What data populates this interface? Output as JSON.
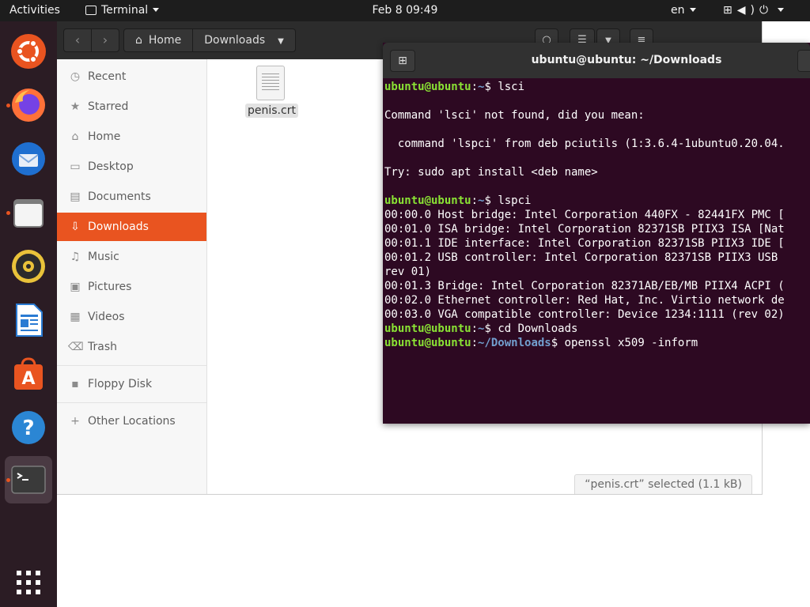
{
  "topbar": {
    "activities": "Activities",
    "app_menu": "Terminal",
    "clock": "Feb 8  09:49",
    "language": "en",
    "system_icons": [
      "network-icon",
      "volume-icon",
      "power-icon"
    ]
  },
  "dock": {
    "items": [
      {
        "name": "ubuntu-software-center",
        "icon": "ubuntu-logo-icon",
        "running": false
      },
      {
        "name": "firefox",
        "icon": "firefox-icon",
        "running": true
      },
      {
        "name": "thunderbird",
        "icon": "thunderbird-icon",
        "running": false
      },
      {
        "name": "files",
        "icon": "folder-icon",
        "running": true
      },
      {
        "name": "rhythmbox",
        "icon": "speaker-icon",
        "running": false
      },
      {
        "name": "libreoffice-writer",
        "icon": "writer-icon",
        "running": false
      },
      {
        "name": "ubuntu-software",
        "icon": "software-bag-icon",
        "running": false
      },
      {
        "name": "help",
        "icon": "help-icon",
        "running": false
      },
      {
        "name": "terminal",
        "icon": "terminal-icon",
        "running": true,
        "active": true
      }
    ],
    "show_apps_icon": "grid-icon"
  },
  "files": {
    "nav": {
      "back": "‹",
      "forward": "›"
    },
    "breadcrumbs": [
      "Home",
      "Downloads"
    ],
    "sidebar": {
      "items": [
        {
          "label": "Recent",
          "icon": "clock-icon",
          "glyph": "◷"
        },
        {
          "label": "Starred",
          "icon": "star-icon",
          "glyph": "★"
        },
        {
          "label": "Home",
          "icon": "home-icon",
          "glyph": "⌂"
        },
        {
          "label": "Desktop",
          "icon": "desktop-icon",
          "glyph": "▭"
        },
        {
          "label": "Documents",
          "icon": "documents-icon",
          "glyph": "▤"
        },
        {
          "label": "Downloads",
          "icon": "download-icon",
          "glyph": "⇩",
          "selected": true
        },
        {
          "label": "Music",
          "icon": "music-icon",
          "glyph": "♫"
        },
        {
          "label": "Pictures",
          "icon": "pictures-icon",
          "glyph": "▣"
        },
        {
          "label": "Videos",
          "icon": "videos-icon",
          "glyph": "▦"
        },
        {
          "label": "Trash",
          "icon": "trash-icon",
          "glyph": "⌫"
        },
        {
          "label": "Floppy Disk",
          "icon": "floppy-icon",
          "glyph": "▪"
        },
        {
          "label": "Other Locations",
          "icon": "plus-icon",
          "glyph": "+"
        }
      ]
    },
    "file_items": [
      {
        "name": "penis.crt",
        "icon": "text-file-icon"
      }
    ],
    "status": "“penis.crt” selected  (1.1 kB)"
  },
  "terminal": {
    "title": "ubuntu@ubuntu: ~/Downloads",
    "colors": {
      "background": "#2d0922",
      "prompt_user": "#8ae234",
      "prompt_path": "#729fcf",
      "text": "#ffffff"
    },
    "lines": [
      {
        "user": "ubuntu@ubuntu",
        "path": "~",
        "cmd": " lsci"
      },
      {
        "text": ""
      },
      {
        "text": "Command 'lsci' not found, did you mean:"
      },
      {
        "text": ""
      },
      {
        "text": "  command 'lspci' from deb pciutils (1:3.6.4-1ubuntu0.20.04."
      },
      {
        "text": ""
      },
      {
        "text": "Try: sudo apt install <deb name>"
      },
      {
        "text": ""
      },
      {
        "user": "ubuntu@ubuntu",
        "path": "~",
        "cmd": " lspci"
      },
      {
        "text": "00:00.0 Host bridge: Intel Corporation 440FX - 82441FX PMC ["
      },
      {
        "text": "00:01.0 ISA bridge: Intel Corporation 82371SB PIIX3 ISA [Nat"
      },
      {
        "text": "00:01.1 IDE interface: Intel Corporation 82371SB PIIX3 IDE ["
      },
      {
        "text": "00:01.2 USB controller: Intel Corporation 82371SB PIIX3 USB"
      },
      {
        "text": "rev 01)"
      },
      {
        "text": "00:01.3 Bridge: Intel Corporation 82371AB/EB/MB PIIX4 ACPI ("
      },
      {
        "text": "00:02.0 Ethernet controller: Red Hat, Inc. Virtio network de"
      },
      {
        "text": "00:03.0 VGA compatible controller: Device 1234:1111 (rev 02)"
      },
      {
        "user": "ubuntu@ubuntu",
        "path": "~",
        "cmd": " cd Downloads"
      },
      {
        "user": "ubuntu@ubuntu",
        "path": "~/Downloads",
        "cmd": " openssl x509 -inform"
      }
    ]
  }
}
